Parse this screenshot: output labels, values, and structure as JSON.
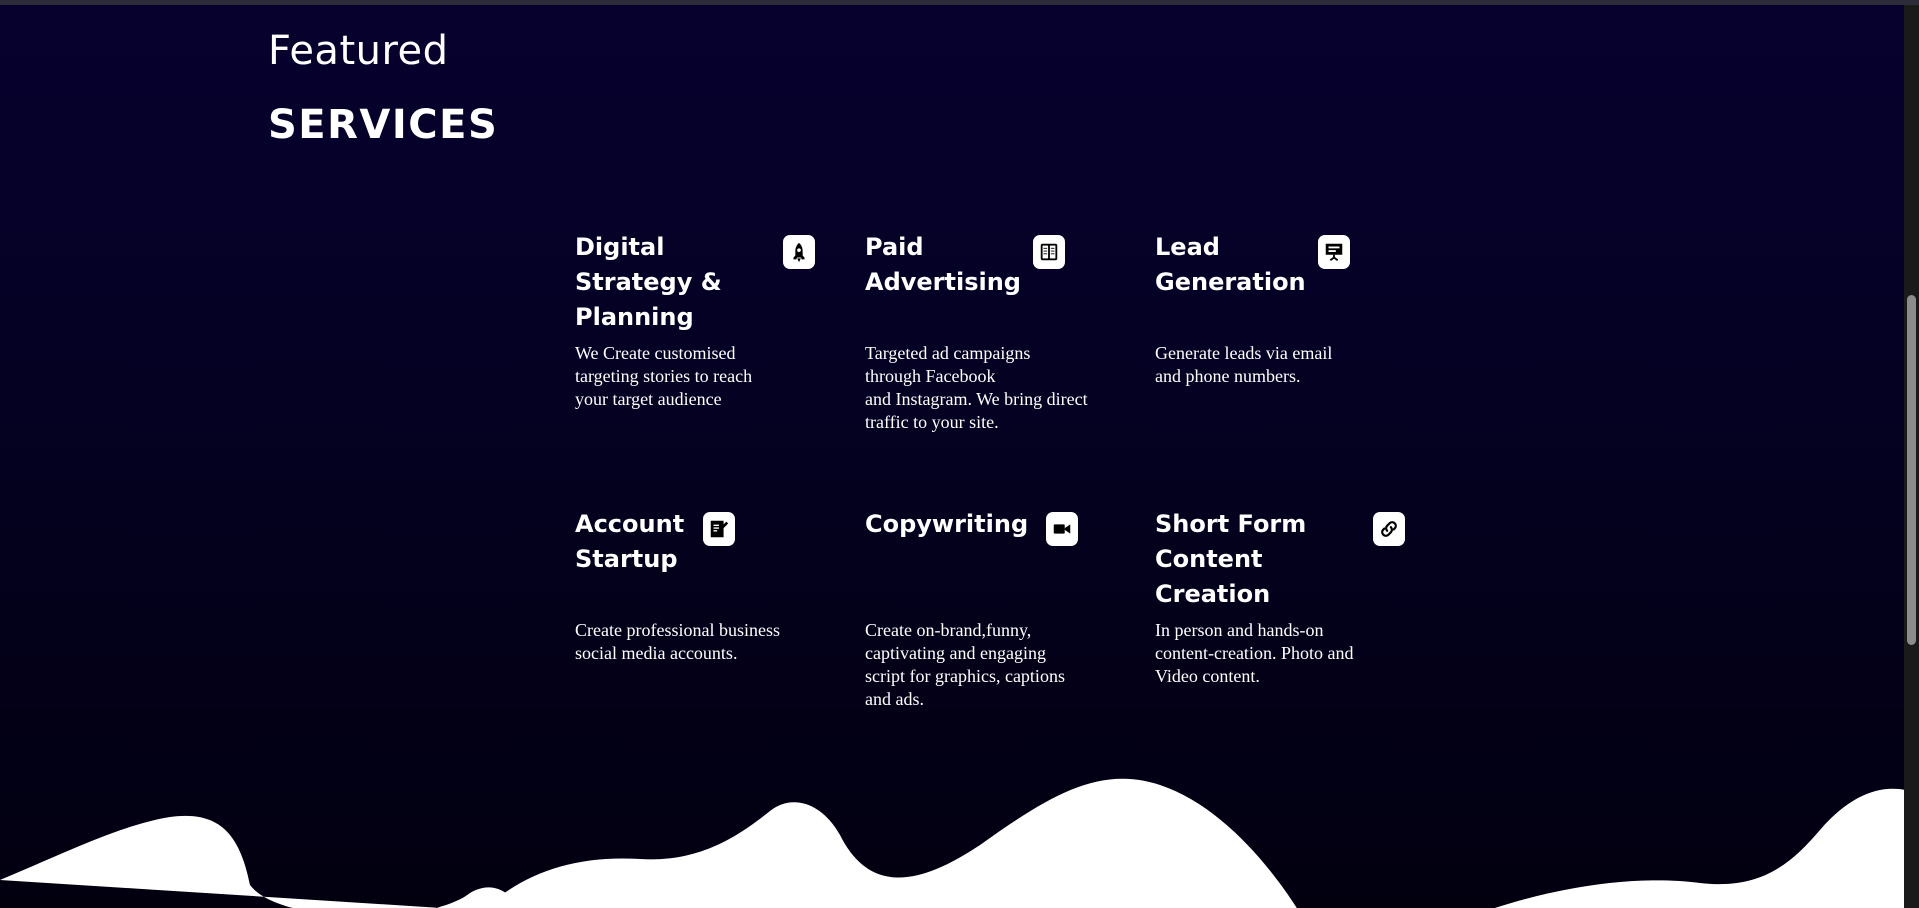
{
  "section": {
    "kicker": "Featured",
    "title": "SERVICES"
  },
  "services": [
    {
      "title": "Digital Strategy & Planning",
      "icon": "rocket-icon",
      "description": "We Create customised\ntargeting stories to reach\nyour target audience"
    },
    {
      "title": "Paid Advertising",
      "icon": "ad-book-icon",
      "description": "Targeted ad campaigns\nthrough Facebook\nand Instagram. We bring direct\ntraffic to your site."
    },
    {
      "title": "Lead Generation",
      "icon": "presentation-icon",
      "description": "Generate leads via email\nand phone numbers."
    },
    {
      "title": "Account Startup",
      "icon": "document-edit-icon",
      "description": "Create professional business\nsocial media accounts."
    },
    {
      "title": "Copywriting",
      "icon": "video-camera-icon",
      "description": "Create on-brand,funny,\ncaptivating and engaging\nscript for graphics, captions\nand ads."
    },
    {
      "title": "Short Form Content Creation",
      "icon": "link-icon",
      "description": "In person and hands-on\ncontent-creation. Photo and\nVideo content."
    }
  ],
  "colors": {
    "background_top": "#07012e",
    "background_bottom": "#02000f",
    "text": "#ffffff",
    "wave": "#ffffff"
  }
}
